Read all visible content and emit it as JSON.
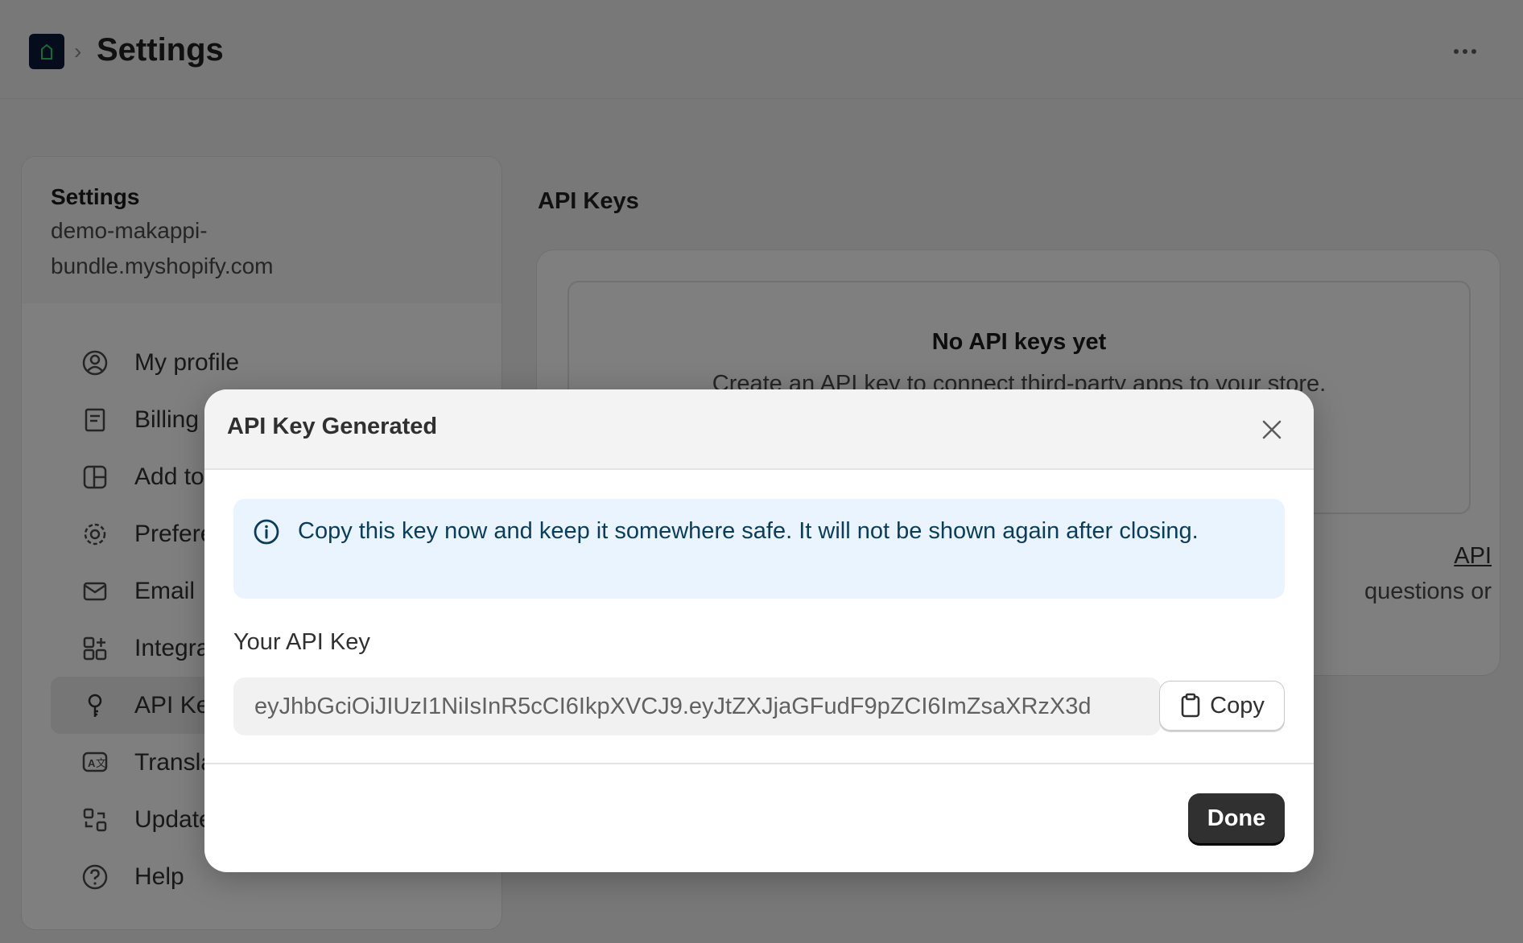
{
  "header": {
    "breadcrumb_sep": "›",
    "title": "Settings"
  },
  "sidebar": {
    "title": "Settings",
    "store_domain": "demo-makappi-bundle.myshopify.com",
    "items": [
      {
        "label": "My profile",
        "icon": "profile-icon"
      },
      {
        "label": "Billing",
        "icon": "receipt-icon"
      },
      {
        "label": "Add to",
        "icon": "layout-icon"
      },
      {
        "label": "Prefere",
        "icon": "gear-icon"
      },
      {
        "label": "Email",
        "icon": "email-icon"
      },
      {
        "label": "Integra",
        "icon": "apps-icon"
      },
      {
        "label": "API Key",
        "icon": "key-icon",
        "active": true
      },
      {
        "label": "Transla",
        "icon": "translate-icon"
      },
      {
        "label": "Update",
        "icon": "update-icon"
      },
      {
        "label": "Help",
        "icon": "help-icon"
      }
    ]
  },
  "main": {
    "title": "API Keys",
    "empty_title": "No API keys yet",
    "empty_desc": "Create an API key to connect third-party apps to your store.",
    "help_link": "API",
    "help_text": "questions or"
  },
  "modal": {
    "title": "API Key Generated",
    "banner": "Copy this key now and keep it somewhere safe. It will not be shown again after closing.",
    "key_label": "Your API Key",
    "key_value": "eyJhbGciOiJIUzI1NiIsInR5cCI6IkpXVCJ9.eyJtZXJjaGFudF9pZCI6ImZsaXRzX3d",
    "copy_label": "Copy",
    "done_label": "Done"
  },
  "colors": {
    "primary_button": "#303030",
    "banner_bg": "#eaf4ff",
    "banner_text": "#0a3d5c",
    "overlay": "rgba(0,0,0,0.5)"
  }
}
